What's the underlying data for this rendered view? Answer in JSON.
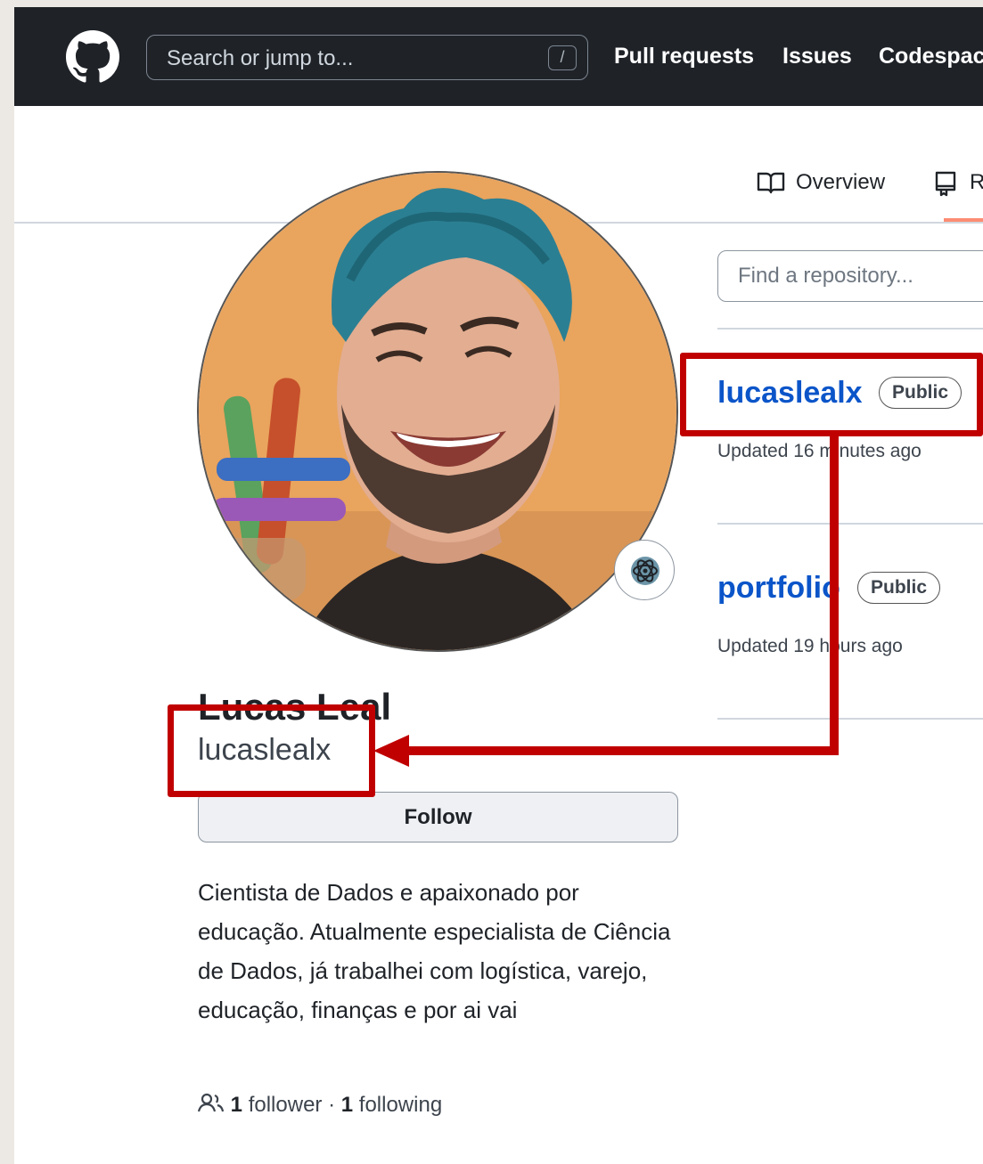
{
  "header": {
    "search_placeholder": "Search or jump to...",
    "search_shortcut": "/",
    "nav": [
      "Pull requests",
      "Issues",
      "Codespaces"
    ]
  },
  "tabs": [
    {
      "label": "Overview",
      "icon": "book-icon"
    },
    {
      "label": "Repositories",
      "icon": "repo-icon",
      "selected": true
    }
  ],
  "profile": {
    "full_name": "Lucas Leal",
    "username": "lucaslealx",
    "follow_label": "Follow",
    "bio": "Cientista de Dados e apaixonado por educação. Atualmente especialista de Ciência de Dados, já trabalhei com logística, varejo, educação, finanças e por ai vai",
    "followers_count": "1",
    "followers_label": "follower",
    "separator": "·",
    "following_count": "1",
    "following_label": "following"
  },
  "repo_search": {
    "placeholder": "Find a repository..."
  },
  "repositories": [
    {
      "name": "lucaslealx",
      "visibility": "Public",
      "updated": "Updated 16 minutes ago"
    },
    {
      "name": "portfolio",
      "visibility": "Public",
      "updated": "Updated 19 hours ago"
    }
  ],
  "colors": {
    "annotation": "#c00000",
    "link": "#0b55c9",
    "header_bg": "#1f2328",
    "tab_underline": "#fd8c73"
  }
}
